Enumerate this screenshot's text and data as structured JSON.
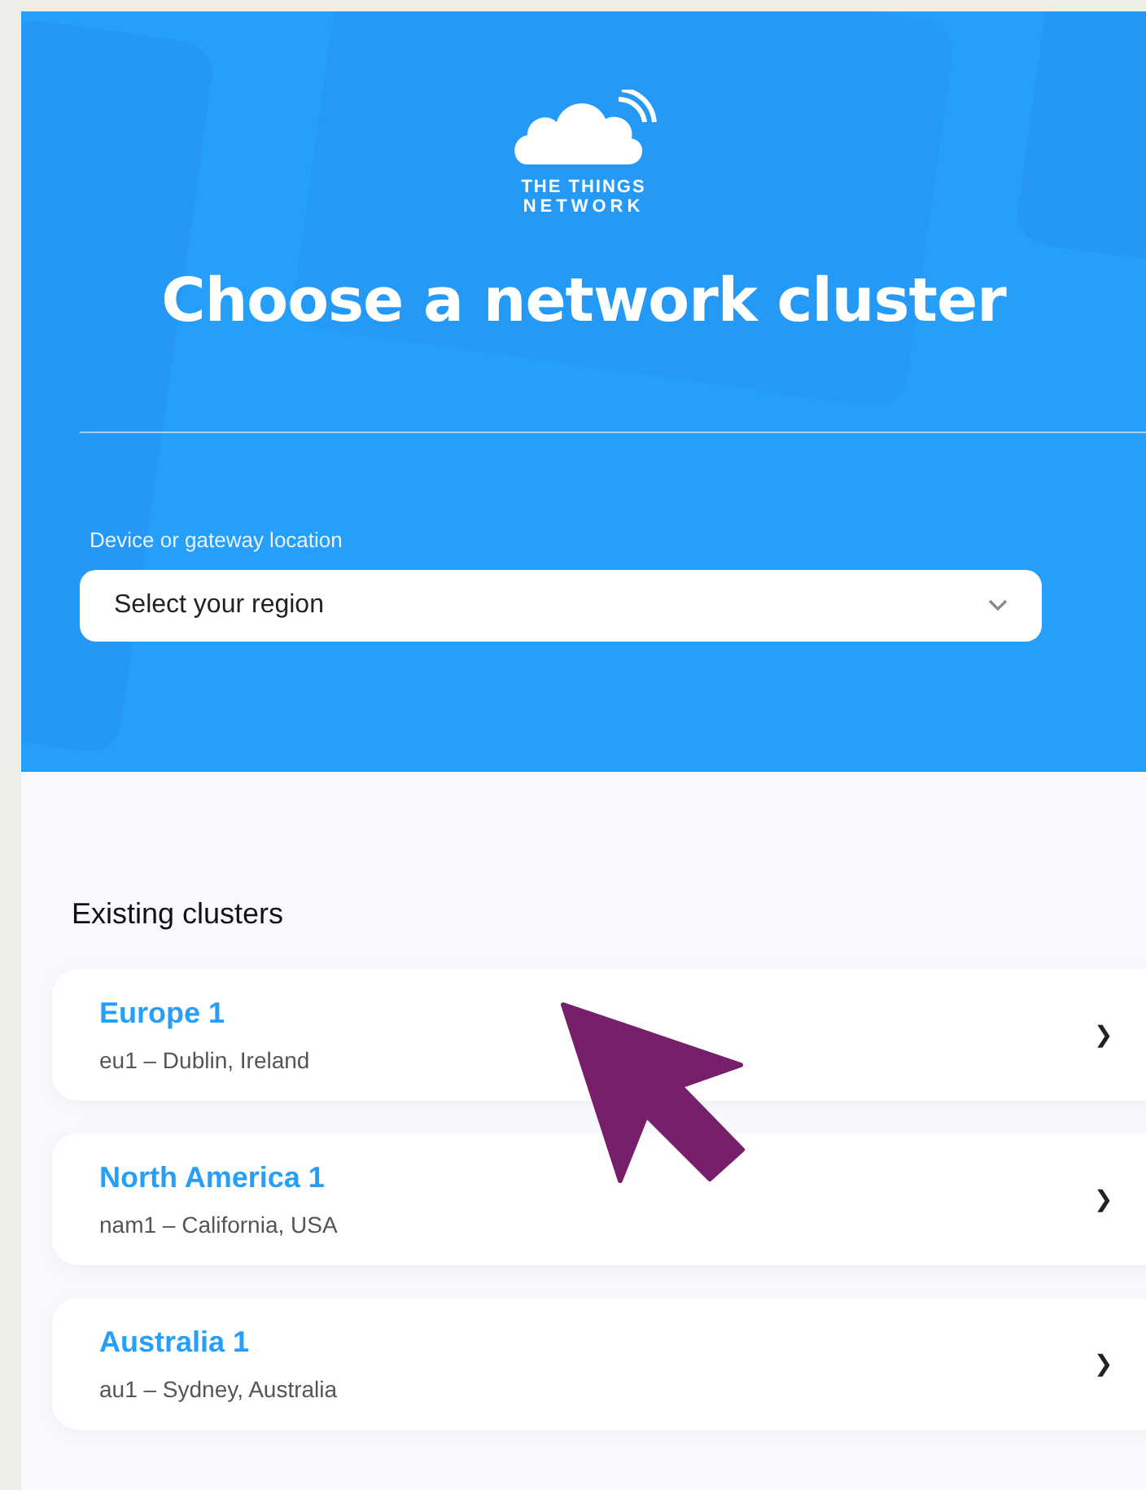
{
  "logo": {
    "line1": "THE THINGS",
    "line2": "NETWORK"
  },
  "title": "Choose a network cluster",
  "region_select": {
    "label": "Device or gateway location",
    "placeholder": "Select your region"
  },
  "clusters_heading": "Existing clusters",
  "clusters": [
    {
      "name": "Europe 1",
      "detail": "eu1 – Dublin, Ireland",
      "chevron": "❯"
    },
    {
      "name": "North America 1",
      "detail": "nam1 – California, USA",
      "chevron": "❯"
    },
    {
      "name": "Australia 1",
      "detail": "au1 – Sydney, Australia",
      "chevron": "❯"
    }
  ]
}
